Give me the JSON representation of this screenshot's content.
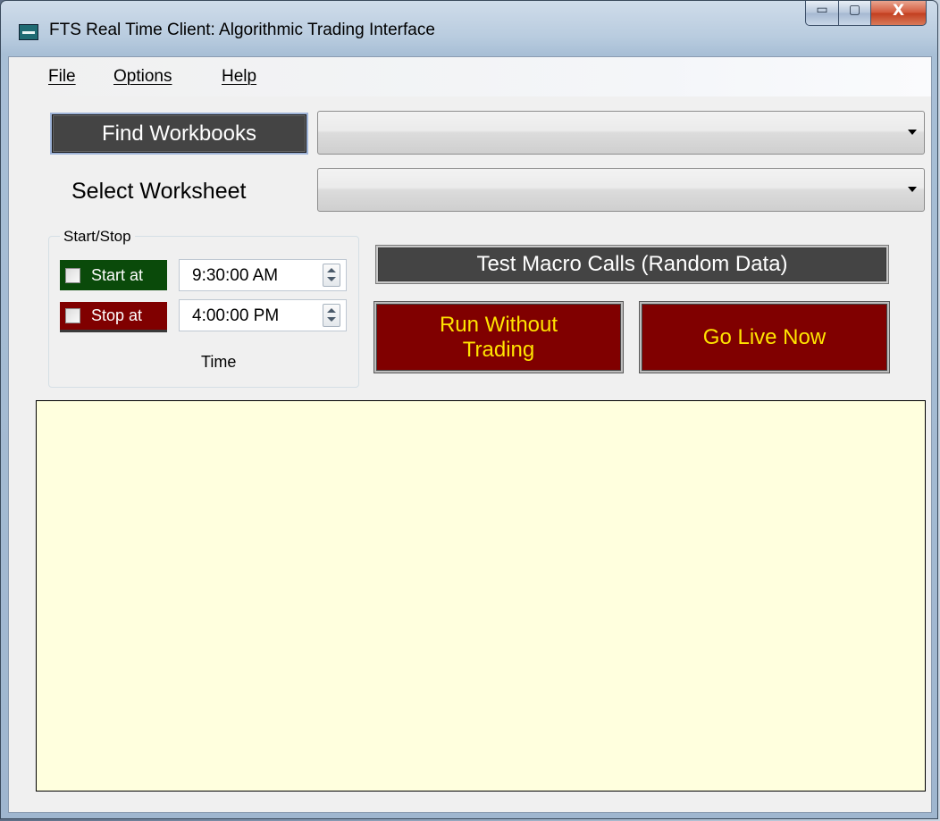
{
  "window": {
    "title": "FTS Real Time Client: Algorithmic Trading Interface",
    "icon": "fts-app-icon",
    "caption_buttons": {
      "minimize": "▭",
      "maximize": "▢",
      "close": "X"
    }
  },
  "menu": {
    "items": [
      {
        "label": "File"
      },
      {
        "label": "Options"
      },
      {
        "label": "Help"
      }
    ]
  },
  "workbook": {
    "find_button": "Find Workbooks",
    "combo_value": ""
  },
  "worksheet": {
    "label": "Select Worksheet",
    "combo_value": ""
  },
  "startstop": {
    "group_title": "Start/Stop",
    "start": {
      "label": "Start at",
      "checked": false,
      "time": "9:30:00 AM",
      "color": "#0a4a0a"
    },
    "stop": {
      "label": "Stop at",
      "checked": false,
      "time": "4:00:00 PM",
      "color": "#800000"
    },
    "time_label": "Time"
  },
  "actions": {
    "test_macro": "Test Macro Calls (Random Data)",
    "run_without_trading": "Run Without Trading",
    "go_live": "Go Live Now"
  },
  "log": {
    "content": ""
  },
  "colors": {
    "accent_dark": "#444444",
    "action_red": "#800000",
    "action_text": "#ffe400",
    "log_bg": "#ffffde"
  }
}
